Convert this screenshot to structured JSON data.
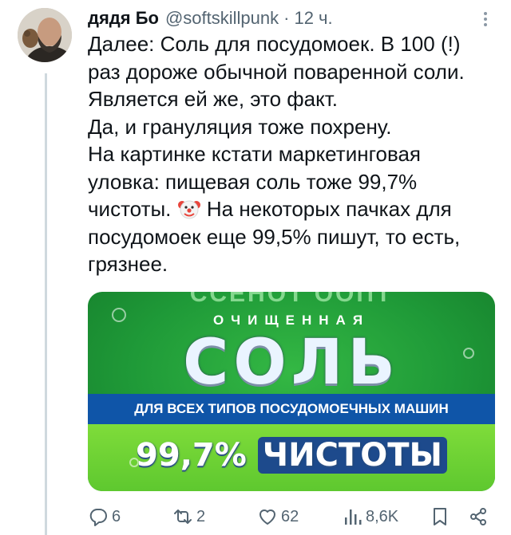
{
  "tweet": {
    "display_name": "дядя Бо",
    "handle": "@softskillpunk",
    "separator": "·",
    "time": "12 ч.",
    "text_lines": [
      "Далее: Соль для посудомоек. В 100 (!)",
      "раз дороже обычной поваренной соли.",
      "Является ей же, это факт.",
      "Да, и грануляция тоже похрену.",
      "На картинке кстати маркетинговая",
      "уловка: пищевая соль тоже 99,7%",
      "чистоты.",
      "На некоторых пачках для",
      "посудомоек еще 99,5% пишут, то есть,",
      "грязнее."
    ],
    "emoji": "clown-face-icon"
  },
  "media": {
    "top_text": "ССЕНОТ ООПТ",
    "subtitle": "ОЧИЩЕННАЯ",
    "title": "СОЛЬ",
    "band_text": "ДЛЯ ВСЕХ ТИПОВ ПОСУДОМОЕЧНЫХ МАШИН",
    "purity_number": "99,7%",
    "purity_word": "ЧИСТОТЫ"
  },
  "actions": {
    "reply_count": "6",
    "retweet_count": "2",
    "like_count": "62",
    "views_count": "8,6K"
  },
  "colors": {
    "text": "#0f1419",
    "secondary": "#536471",
    "band_blue": "#0f55a8",
    "green": "#1f9a38"
  }
}
